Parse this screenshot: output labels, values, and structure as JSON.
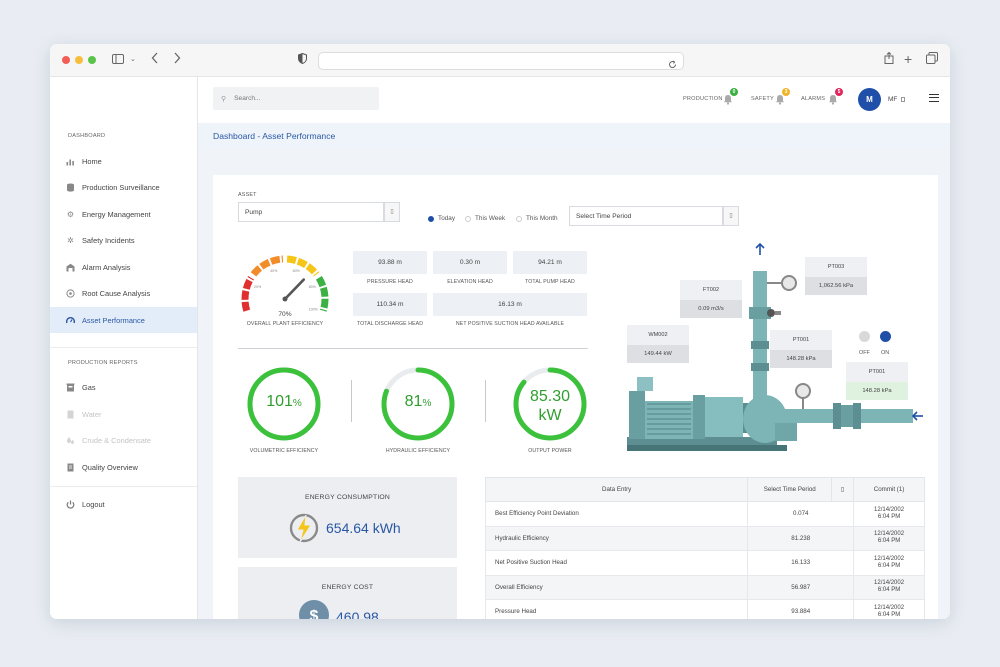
{
  "sidebar": {
    "section_dashboard": "DASHBOARD",
    "items": [
      {
        "label": "Home"
      },
      {
        "label": "Production Surveillance"
      },
      {
        "label": "Energy Management"
      },
      {
        "label": "Safety Incidents"
      },
      {
        "label": "Alarm Analysis"
      },
      {
        "label": "Root Cause Analysis"
      },
      {
        "label": "Asset Performance"
      }
    ],
    "section_reports": "PRODUCTION REPORTS",
    "reports": [
      {
        "label": "Gas"
      },
      {
        "label": "Water"
      },
      {
        "label": "Crude & Condensate"
      },
      {
        "label": "Quality Overview"
      }
    ],
    "logout": "Logout"
  },
  "topbar": {
    "search_placeholder": "Search...",
    "production": {
      "label": "PRODUCTION",
      "count": "0",
      "color": "#3cb043"
    },
    "safety": {
      "label": "SAFETY",
      "count": "3",
      "color": "#f0b429"
    },
    "alarms": {
      "label": "ALARMS",
      "count": "5",
      "color": "#e0245e"
    },
    "avatar": "M",
    "user": "MF"
  },
  "page": {
    "title": "Dashboard - Asset Performance"
  },
  "filters": {
    "asset_label": "ASSET",
    "asset_value": "Pump",
    "radios": [
      "Today",
      "This Week",
      "This Month"
    ],
    "selected": "Today",
    "time_period": "Select Time Period"
  },
  "gauge": {
    "value": "70%",
    "fraction": 0.7,
    "label": "OVERALL PLANT EFFICIENCY",
    "ticks": [
      "20%",
      "40%",
      "60%",
      "80%",
      "100%"
    ]
  },
  "metrics": [
    {
      "value": "93.88 m",
      "label": "PRESSURE HEAD"
    },
    {
      "value": "0.30 m",
      "label": "ELEVATION HEAD"
    },
    {
      "value": "94.21 m",
      "label": "TOTAL PUMP HEAD"
    },
    {
      "value": "110.34 m",
      "label": "TOTAL DISCHARGE HEAD"
    },
    {
      "value": "16.13 m",
      "label": "NET POSITIVE SUCTION HEAD AVAILABLE"
    }
  ],
  "rings": [
    {
      "value": "101",
      "unit": "%",
      "fraction": 1.0,
      "label": "VOLUMETRIC EFFICIENCY"
    },
    {
      "value": "81",
      "unit": "%",
      "fraction": 0.81,
      "label": "HYDRAULIC EFFICIENCY"
    },
    {
      "value": "85.30",
      "unit": "kW",
      "fraction": 0.86,
      "label": "OUTPUT POWER"
    }
  ],
  "energy_consumption": {
    "title": "ENERGY CONSUMPTION",
    "value": "654.64 kWh"
  },
  "energy_cost": {
    "title": "ENERGY COST",
    "value": "460.98"
  },
  "pump": {
    "ft002": {
      "title": "FT002",
      "value": "0.09 m3/s"
    },
    "pt003": {
      "title": "PT003",
      "value": "1,062.56 kPa"
    },
    "wm002": {
      "title": "WM002",
      "value": "149.44 kW"
    },
    "pt001a": {
      "title": "PT001",
      "value": "148.28 kPa"
    },
    "pt001b": {
      "title": "PT001",
      "value": "148.28 kPa"
    },
    "off": "OFF",
    "on": "ON"
  },
  "table": {
    "headers": [
      "Data Entry",
      "Select Time Period",
      "Commit (1)"
    ],
    "rows": [
      {
        "name": "Best Efficiency Point Deviation",
        "value": "0.074",
        "date": "12/14/2002",
        "time": "6:04 PM"
      },
      {
        "name": "Hydraulic Efficiency",
        "value": "81.238",
        "date": "12/14/2002",
        "time": "6:04 PM"
      },
      {
        "name": "Net Positive Suction Head",
        "value": "16.133",
        "date": "12/14/2002",
        "time": "6:04 PM"
      },
      {
        "name": "Overall Efficiency",
        "value": "56.987",
        "date": "12/14/2002",
        "time": "6:04 PM"
      },
      {
        "name": "Pressure Head",
        "value": "93.884",
        "date": "12/14/2002",
        "time": "6:04 PM"
      }
    ]
  },
  "colors": {
    "accent": "#2a57a5",
    "ring_green": "#3cc13c",
    "gauge_arc": [
      "#e02f2f",
      "#f28c28",
      "#f5c518",
      "#3cb043"
    ]
  }
}
